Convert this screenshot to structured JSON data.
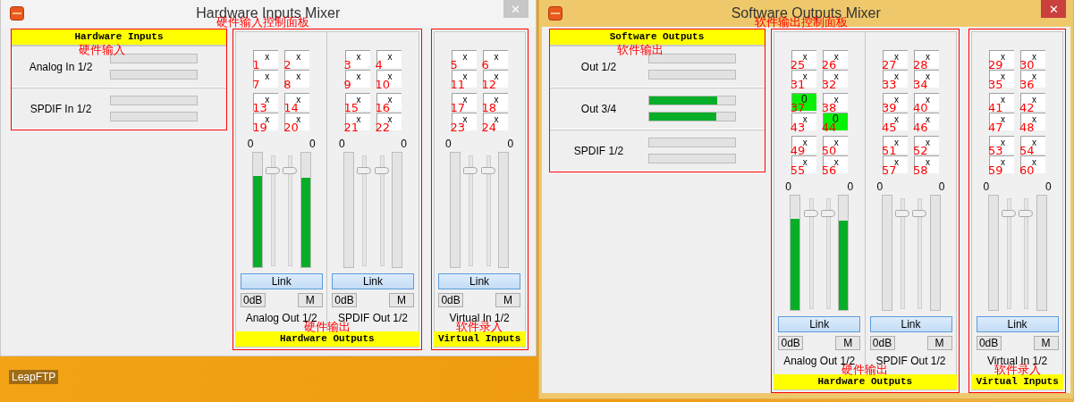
{
  "desktop": {
    "icon_label": "LeapFTP"
  },
  "windows": [
    {
      "title": "Hardware Inputs Mixer",
      "active": false,
      "close": "✕",
      "inputs": {
        "header": "Hardware Inputs",
        "note": "硬件输入",
        "rows": [
          {
            "name": "Analog In 1/2",
            "meters": [
              {
                "level": 0
              },
              {
                "level": 0
              }
            ]
          },
          {
            "name": "SPDIF In 1/2",
            "meters": [
              {
                "level": 0
              },
              {
                "level": 0
              }
            ]
          }
        ]
      },
      "mixer_note": "硬件输入控制面板",
      "groups": [
        {
          "footer": "Hardware Outputs",
          "note": "硬件输出",
          "strips": [
            {
              "name": "Analog Out 1/2",
              "peaks": [
                "0",
                "0"
              ],
              "meters": [
                {
                  "level": 0.8
                },
                {
                  "level": 0.78
                }
              ],
              "faders": [
                {
                  "level": 0.9
                },
                {
                  "level": 0.9
                }
              ],
              "link": "Link",
              "zero_db": "0dB",
              "mute": "M",
              "cells": [
                [
                  {
                    "value": "x",
                    "active": false,
                    "note": "1"
                  },
                  {
                    "value": "x",
                    "active": false,
                    "note": "2"
                  }
                ],
                [
                  {
                    "value": "x",
                    "active": false,
                    "note": "7"
                  },
                  {
                    "value": "x",
                    "active": false,
                    "note": "8"
                  }
                ],
                [
                  {
                    "value": "x",
                    "active": false,
                    "note": "13"
                  },
                  {
                    "value": "x",
                    "active": false,
                    "note": "14"
                  }
                ],
                [
                  {
                    "value": "x",
                    "active": false,
                    "note": "19"
                  },
                  {
                    "value": "x",
                    "active": false,
                    "note": "20"
                  }
                ]
              ]
            },
            {
              "name": "SPDIF Out 1/2",
              "peaks": [
                "0",
                "0"
              ],
              "meters": [
                {
                  "level": 0
                },
                {
                  "level": 0
                }
              ],
              "faders": [
                {
                  "level": 0.9
                },
                {
                  "level": 0.9
                }
              ],
              "link": "Link",
              "zero_db": "0dB",
              "mute": "M",
              "cells": [
                [
                  {
                    "value": "x",
                    "active": false,
                    "note": "3"
                  },
                  {
                    "value": "x",
                    "active": false,
                    "note": "4"
                  }
                ],
                [
                  {
                    "value": "x",
                    "active": false,
                    "note": "9"
                  },
                  {
                    "value": "x",
                    "active": false,
                    "note": "10"
                  }
                ],
                [
                  {
                    "value": "x",
                    "active": false,
                    "note": "15"
                  },
                  {
                    "value": "x",
                    "active": false,
                    "note": "16"
                  }
                ],
                [
                  {
                    "value": "x",
                    "active": false,
                    "note": "21"
                  },
                  {
                    "value": "x",
                    "active": false,
                    "note": "22"
                  }
                ]
              ]
            }
          ]
        },
        {
          "footer": "Virtual Inputs",
          "note": "软件录入",
          "strips": [
            {
              "name": "Virtual In 1/2",
              "peaks": [
                "0",
                "0"
              ],
              "meters": [
                {
                  "level": 0
                },
                {
                  "level": 0
                }
              ],
              "faders": [
                {
                  "level": 0.9
                },
                {
                  "level": 0.9
                }
              ],
              "link": "Link",
              "zero_db": "0dB",
              "mute": "M",
              "cells": [
                [
                  {
                    "value": "x",
                    "active": false,
                    "note": "5"
                  },
                  {
                    "value": "x",
                    "active": false,
                    "note": "6"
                  }
                ],
                [
                  {
                    "value": "x",
                    "active": false,
                    "note": "11"
                  },
                  {
                    "value": "x",
                    "active": false,
                    "note": "12"
                  }
                ],
                [
                  {
                    "value": "x",
                    "active": false,
                    "note": "17"
                  },
                  {
                    "value": "x",
                    "active": false,
                    "note": "18"
                  }
                ],
                [
                  {
                    "value": "x",
                    "active": false,
                    "note": "23"
                  },
                  {
                    "value": "x",
                    "active": false,
                    "note": "24"
                  }
                ]
              ]
            }
          ]
        }
      ]
    },
    {
      "title": "Software Outputs Mixer",
      "active": true,
      "close": "✕",
      "inputs": {
        "header": "Software Outputs",
        "note": "软件输出",
        "rows": [
          {
            "name": "Out 1/2",
            "meters": [
              {
                "level": 0
              },
              {
                "level": 0
              }
            ]
          },
          {
            "name": "Out 3/4",
            "meters": [
              {
                "level": 0.8
              },
              {
                "level": 0.79
              }
            ]
          },
          {
            "name": "SPDIF 1/2",
            "meters": [
              {
                "level": 0
              },
              {
                "level": 0
              }
            ]
          }
        ]
      },
      "mixer_note": "软件输出控制面板",
      "groups": [
        {
          "footer": "Hardware Outputs",
          "note": "硬件输出",
          "strips": [
            {
              "name": "Analog Out 1/2",
              "peaks": [
                "0",
                "0"
              ],
              "meters": [
                {
                  "level": 0.8
                },
                {
                  "level": 0.78
                }
              ],
              "faders": [
                {
                  "level": 0.9
                },
                {
                  "level": 0.9
                }
              ],
              "link": "Link",
              "zero_db": "0dB",
              "mute": "M",
              "cells": [
                [
                  {
                    "value": "x",
                    "active": false,
                    "note": "25"
                  },
                  {
                    "value": "x",
                    "active": false,
                    "note": "26"
                  }
                ],
                [
                  {
                    "value": "x",
                    "active": false,
                    "note": "31"
                  },
                  {
                    "value": "x",
                    "active": false,
                    "note": "32"
                  }
                ],
                [
                  {
                    "value": "0",
                    "active": true,
                    "note": "37"
                  },
                  {
                    "value": "x",
                    "active": false,
                    "note": "38"
                  }
                ],
                [
                  {
                    "value": "x",
                    "active": false,
                    "note": "43"
                  },
                  {
                    "value": "0",
                    "active": true,
                    "note": "44"
                  }
                ],
                [
                  {
                    "value": "x",
                    "active": false,
                    "note": "49"
                  },
                  {
                    "value": "x",
                    "active": false,
                    "note": "50"
                  }
                ],
                [
                  {
                    "value": "x",
                    "active": false,
                    "note": "55"
                  },
                  {
                    "value": "x",
                    "active": false,
                    "note": "56"
                  }
                ]
              ]
            },
            {
              "name": "SPDIF Out 1/2",
              "peaks": [
                "0",
                "0"
              ],
              "meters": [
                {
                  "level": 0
                },
                {
                  "level": 0
                }
              ],
              "faders": [
                {
                  "level": 0.9
                },
                {
                  "level": 0.9
                }
              ],
              "link": "Link",
              "zero_db": "0dB",
              "mute": "M",
              "cells": [
                [
                  {
                    "value": "x",
                    "active": false,
                    "note": "27"
                  },
                  {
                    "value": "x",
                    "active": false,
                    "note": "28"
                  }
                ],
                [
                  {
                    "value": "x",
                    "active": false,
                    "note": "33"
                  },
                  {
                    "value": "x",
                    "active": false,
                    "note": "34"
                  }
                ],
                [
                  {
                    "value": "x",
                    "active": false,
                    "note": "39"
                  },
                  {
                    "value": "x",
                    "active": false,
                    "note": "40"
                  }
                ],
                [
                  {
                    "value": "x",
                    "active": false,
                    "note": "45"
                  },
                  {
                    "value": "x",
                    "active": false,
                    "note": "46"
                  }
                ],
                [
                  {
                    "value": "x",
                    "active": false,
                    "note": "51"
                  },
                  {
                    "value": "x",
                    "active": false,
                    "note": "52"
                  }
                ],
                [
                  {
                    "value": "x",
                    "active": false,
                    "note": "57"
                  },
                  {
                    "value": "x",
                    "active": false,
                    "note": "58"
                  }
                ]
              ]
            }
          ]
        },
        {
          "footer": "Virtual Inputs",
          "note": "软件录入",
          "strips": [
            {
              "name": "Virtual In 1/2",
              "peaks": [
                "0",
                "0"
              ],
              "meters": [
                {
                  "level": 0
                },
                {
                  "level": 0
                }
              ],
              "faders": [
                {
                  "level": 0.9
                },
                {
                  "level": 0.9
                }
              ],
              "link": "Link",
              "zero_db": "0dB",
              "mute": "M",
              "cells": [
                [
                  {
                    "value": "x",
                    "active": false,
                    "note": "29"
                  },
                  {
                    "value": "x",
                    "active": false,
                    "note": "30"
                  }
                ],
                [
                  {
                    "value": "x",
                    "active": false,
                    "note": "35"
                  },
                  {
                    "value": "x",
                    "active": false,
                    "note": "36"
                  }
                ],
                [
                  {
                    "value": "x",
                    "active": false,
                    "note": "41"
                  },
                  {
                    "value": "x",
                    "active": false,
                    "note": "42"
                  }
                ],
                [
                  {
                    "value": "x",
                    "active": false,
                    "note": "47"
                  },
                  {
                    "value": "x",
                    "active": false,
                    "note": "48"
                  }
                ],
                [
                  {
                    "value": "x",
                    "active": false,
                    "note": "53"
                  },
                  {
                    "value": "x",
                    "active": false,
                    "note": "54"
                  }
                ],
                [
                  {
                    "value": "x",
                    "active": false,
                    "note": "59"
                  },
                  {
                    "value": "x",
                    "active": false,
                    "note": "60"
                  }
                ]
              ]
            }
          ]
        }
      ]
    }
  ]
}
